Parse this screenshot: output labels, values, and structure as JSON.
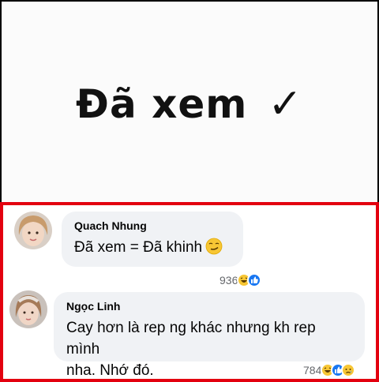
{
  "header": {
    "caption": "Đã xem",
    "check_mark": "✓"
  },
  "comments": [
    {
      "author": "Quach Nhung",
      "text": "Đã xem = Đã khinh",
      "emoji_icon": "smirk-face-icon",
      "reaction_count": "936",
      "reactions": [
        "haha-icon",
        "like-icon"
      ]
    },
    {
      "author": "Ngọc Linh",
      "text_line1": "Cay hơn là rep ng khác nhưng kh rep mình",
      "text_line2": "nha. Nhớ đó.",
      "reaction_count": "784",
      "reactions": [
        "haha-icon",
        "like-icon",
        "sad-icon"
      ]
    }
  ],
  "colors": {
    "highlight_border": "#e3000f",
    "bubble_bg": "#f0f2f5",
    "like_blue": "#1877f2",
    "haha_yellow": "#f7c634"
  }
}
